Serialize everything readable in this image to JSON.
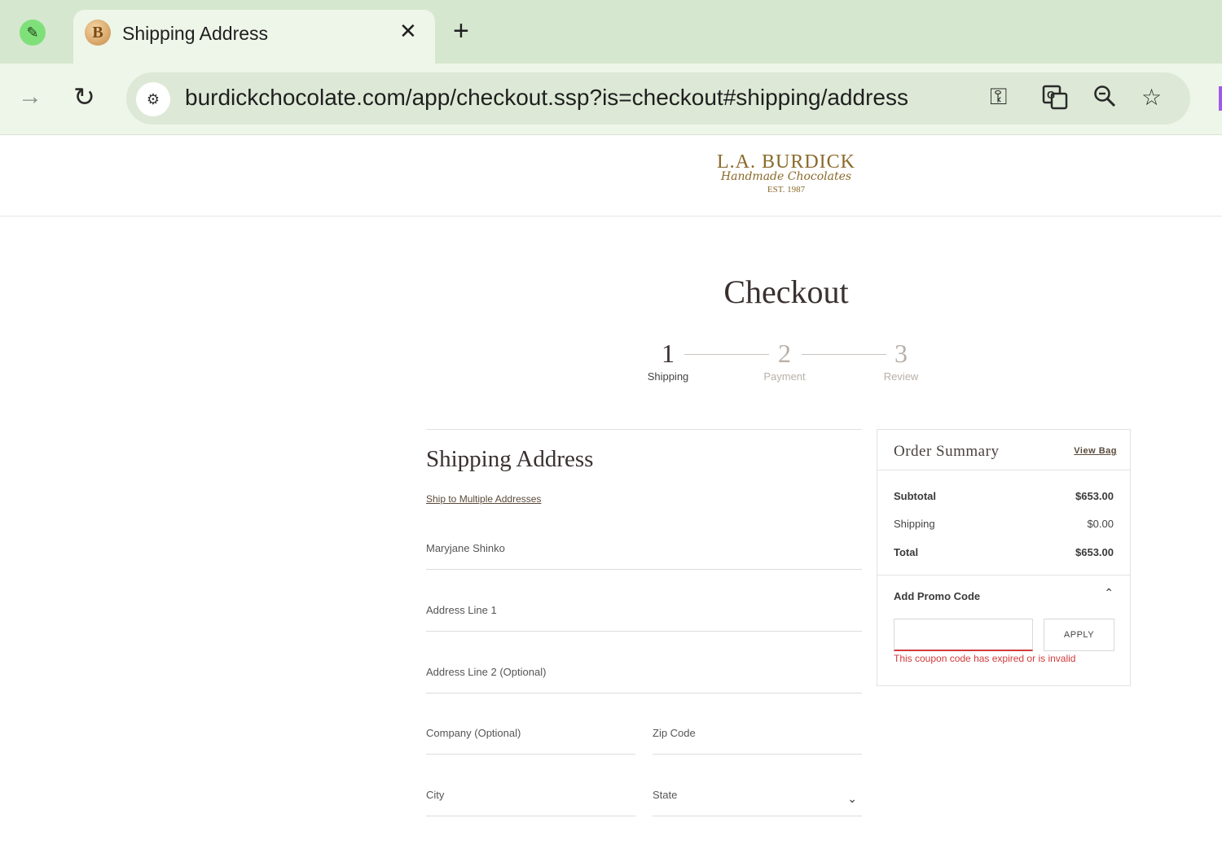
{
  "browser": {
    "tab_title": "Shipping Address",
    "tab_favicon_letter": "B",
    "close_glyph": "✕",
    "new_tab_glyph": "+",
    "url": "burdickchocolate.com/app/checkout.ssp?is=checkout#shipping/address",
    "icons": [
      "profile-icon",
      "forward-icon",
      "reload-icon",
      "site-info-icon",
      "password-key-icon",
      "translate-icon",
      "zoom-icon",
      "bookmark-star-icon"
    ]
  },
  "site": {
    "logo_main": "L.A. BURDICK",
    "logo_script": "Handmade Chocolates",
    "logo_est": "EST. 1987"
  },
  "checkout": {
    "title": "Checkout",
    "steps": [
      {
        "num": "1",
        "label": "Shipping"
      },
      {
        "num": "2",
        "label": "Payment"
      },
      {
        "num": "3",
        "label": "Review"
      }
    ]
  },
  "shipping_form": {
    "title": "Shipping Address",
    "multi_link": "Ship to Multiple Addresses",
    "full_name_value": "Maryjane Shinko",
    "address1_placeholder": "Address Line 1",
    "address2_placeholder": "Address Line 2 (Optional)",
    "company_placeholder": "Company (Optional)",
    "zip_placeholder": "Zip Code",
    "city_placeholder": "City",
    "state_placeholder": "State"
  },
  "order_summary": {
    "title": "Order Summary",
    "view_bag": "View Bag",
    "subtotal_label": "Subtotal",
    "subtotal_value": "$653.00",
    "shipping_label": "Shipping",
    "shipping_value": "$0.00",
    "total_label": "Total",
    "total_value": "$653.00",
    "promo_label": "Add Promo Code",
    "apply_label": "APPLY",
    "promo_error": "This coupon code has expired or is invalid"
  },
  "colors": {
    "tabbar_bg": "#d6e7cf",
    "brand_gold": "#8a6a2a",
    "error_red": "#d23b3b"
  }
}
